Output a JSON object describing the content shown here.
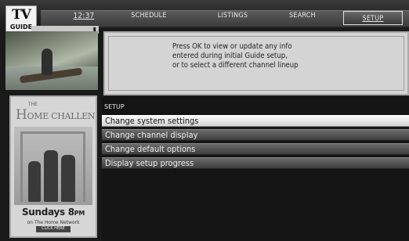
{
  "header": {
    "logo_line1": "TV",
    "logo_line2": "GUIDE",
    "time": "12:37",
    "nav": [
      "SCHEDULE",
      "LISTINGS",
      "SEARCH",
      "SETUP"
    ],
    "active_tab": "SETUP"
  },
  "info": {
    "lines": [
      "Press OK to view or update any info",
      "entered during initial Guide setup,",
      "or to select a different channel lineup"
    ]
  },
  "setup": {
    "title": "SETUP",
    "items": [
      "Change system settings",
      "Change channel display",
      "Change default options",
      "Display setup progress"
    ],
    "selected_index": 0
  },
  "ad": {
    "brand_small": "THE",
    "brand_initial": "H",
    "brand_rest": "OME CHALLENGE",
    "day": "Sundays 8",
    "time_suffix": "PM",
    "network": "on The Home Network",
    "cta": "CLICK HERE"
  },
  "colors": {
    "background": "#1a1a1a",
    "highlight": "#f5f5f5",
    "menu_item": "#555555",
    "info_panel": "#d4d4d4"
  }
}
